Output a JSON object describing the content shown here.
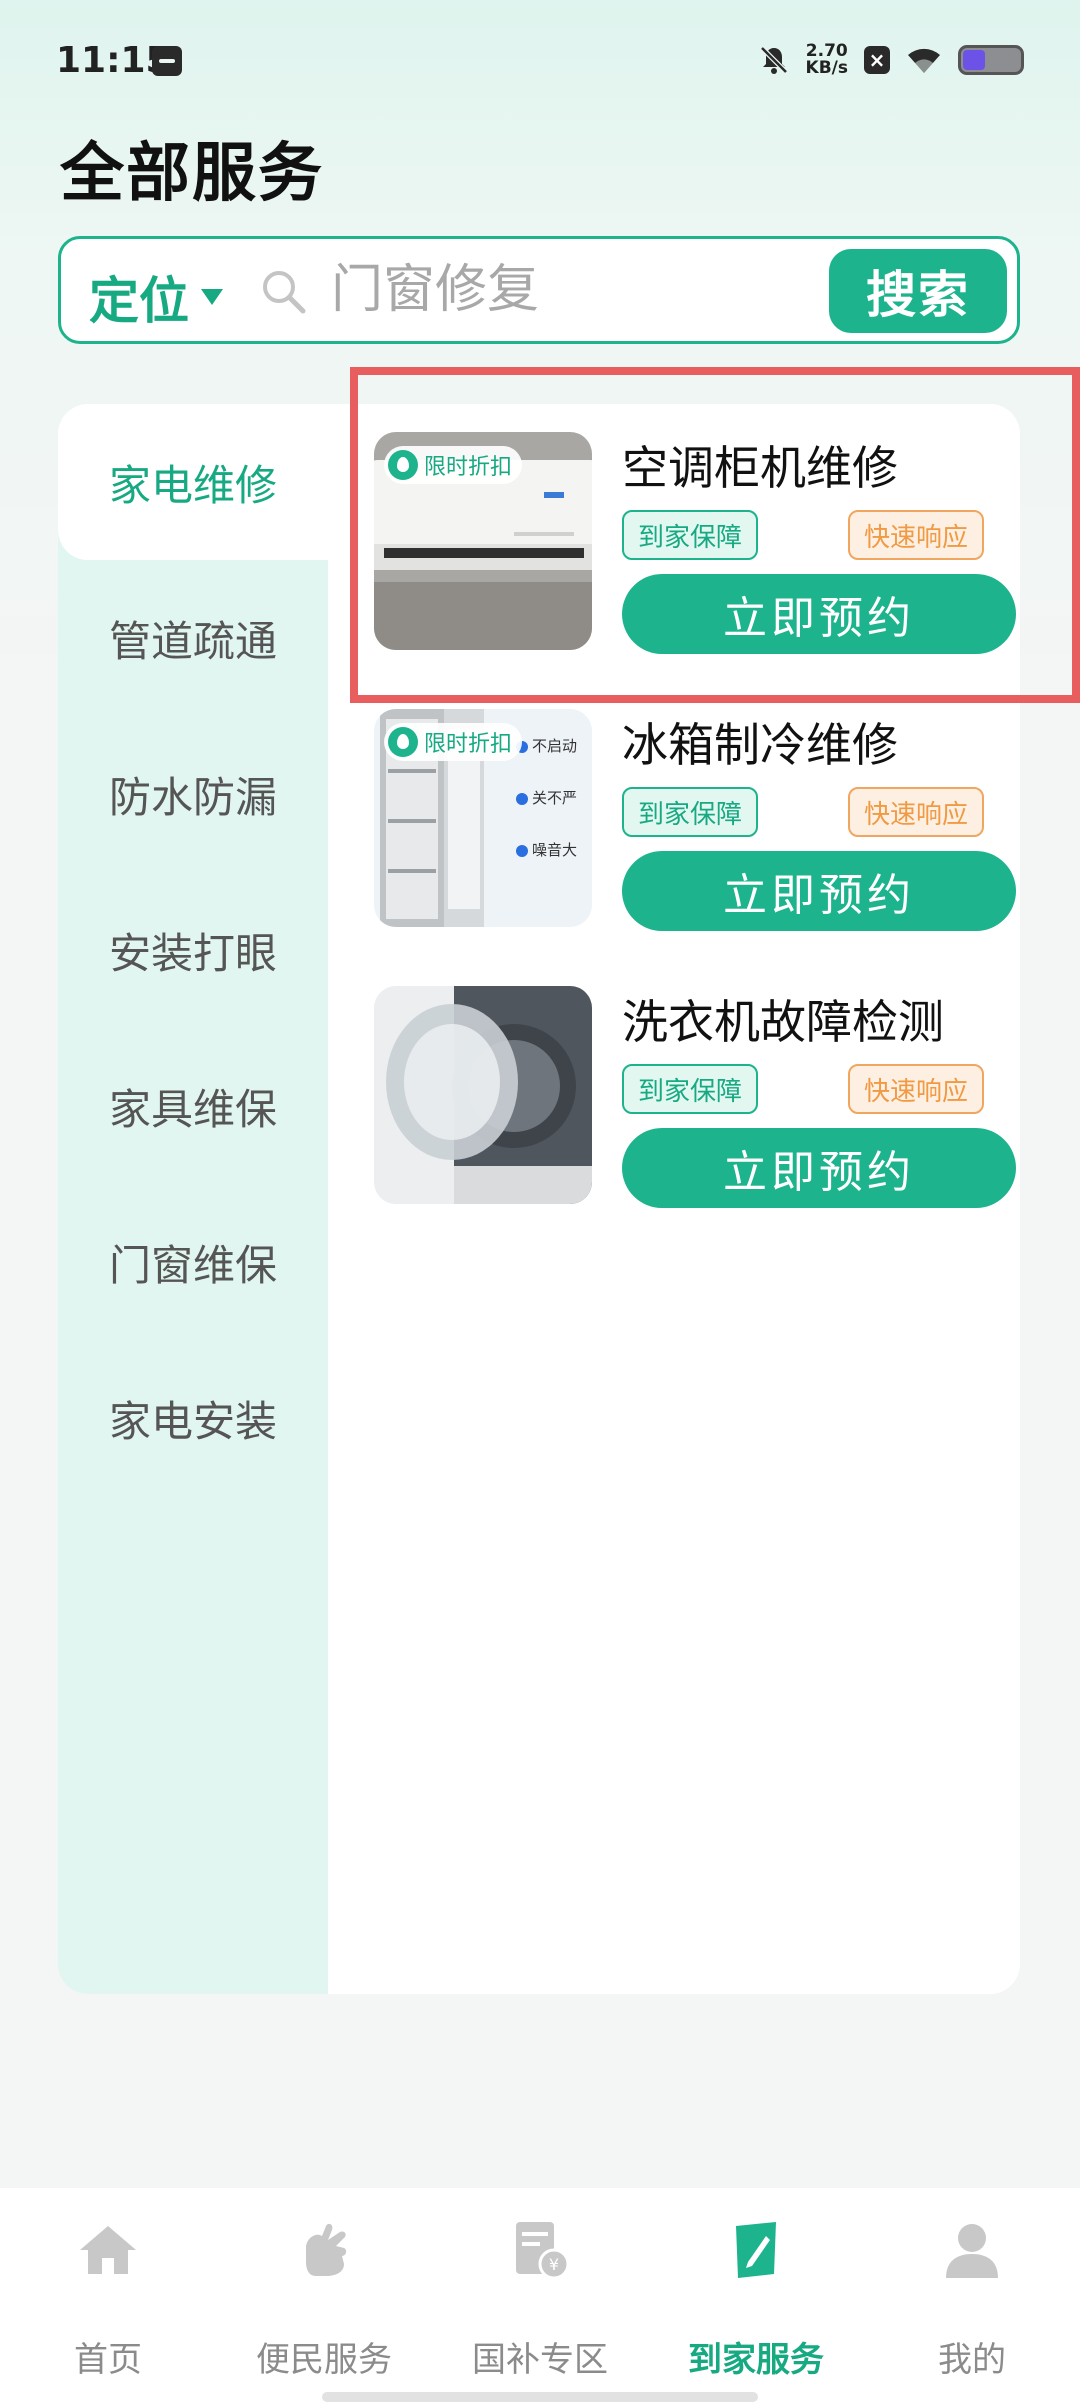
{
  "status": {
    "time": "11:15",
    "net_speed_value": "2.70",
    "net_speed_unit": "KB/s",
    "close_mark": "×"
  },
  "page": {
    "title": "全部服务"
  },
  "search": {
    "location_label": "定位",
    "placeholder": "门窗修复",
    "button_label": "搜索"
  },
  "sidebar": {
    "items": [
      {
        "label": "家电维修",
        "active": true
      },
      {
        "label": "管道疏通"
      },
      {
        "label": "防水防漏"
      },
      {
        "label": "安装打眼"
      },
      {
        "label": "家具维保"
      },
      {
        "label": "门窗维保"
      },
      {
        "label": "家电安装"
      }
    ]
  },
  "services": [
    {
      "title": "空调柜机维修",
      "badge": "限时折扣",
      "tags": [
        "到家保障",
        "快速响应"
      ],
      "button": "立即预约",
      "image_icon": "air-conditioner-icon"
    },
    {
      "title": "冰箱制冷维修",
      "badge": "限时折扣",
      "tags": [
        "到家保障",
        "快速响应"
      ],
      "button": "立即预约",
      "image_icon": "fridge-icon",
      "image_notes": [
        "不启动",
        "关不严",
        "噪音大"
      ]
    },
    {
      "title": "洗衣机故障检测",
      "badge": "",
      "tags": [
        "到家保障",
        "快速响应"
      ],
      "button": "立即预约",
      "image_icon": "washing-machine-icon"
    }
  ],
  "bottom_nav": {
    "items": [
      {
        "label": "首页",
        "icon": "home-icon"
      },
      {
        "label": "便民服务",
        "icon": "hand-icon"
      },
      {
        "label": "国补专区",
        "icon": "subsidy-icon"
      },
      {
        "label": "到家服务",
        "icon": "home-service-icon",
        "active": true
      },
      {
        "label": "我的",
        "icon": "profile-icon"
      }
    ]
  },
  "colors": {
    "accent": "#1db38d",
    "accent_text": "#17a982",
    "tag_orange": "#f09a44",
    "highlight": "#e85d5d"
  }
}
